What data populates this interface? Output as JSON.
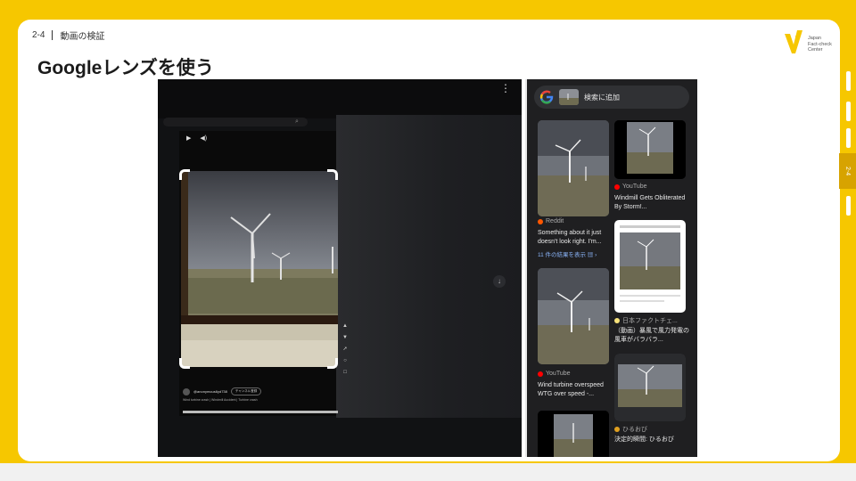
{
  "slide": {
    "section_number": "2-4",
    "section_title": "動画の検証",
    "title": "Googleレンズを使う",
    "side_tab_label": "2-4",
    "logo_lines": [
      "Japan",
      "Fact-check",
      "Center"
    ]
  },
  "colors": {
    "brand_yellow": "#f6c700",
    "tab_active": "#d7a300",
    "lens_dark": "#1f1f21",
    "link_blue": "#8ab4f8"
  },
  "left_screenshot": {
    "menu_icon": "more-vertical-icon",
    "play_icon": "play-icon",
    "volume_icon": "volume-icon",
    "channel_handle": "@anonymous6yd738",
    "subscribe_label": "チャンネル登録",
    "caption": "Wind turbine crash | Windmill Accident | Turbine crash",
    "action_icons": [
      "like-icon",
      "dislike-icon",
      "share-icon",
      "remix-icon",
      "more-icon"
    ]
  },
  "right_screenshot": {
    "search_chip_label": "検索に追加",
    "results": [
      {
        "source": "Reddit",
        "source_color": "#ff5700",
        "title": "Something about it just doesn't look right. I'm...",
        "link": "11 件の結果を表示"
      },
      {
        "source": "YouTube",
        "source_color": "#ff0000",
        "title": "Windmill Gets Obliterated By Storm!..."
      },
      {
        "source": "日本ファクトチェ...",
        "source_color": "#f6e27a",
        "title": "（動画）暴風で風力発電の風車がバラバラ..."
      },
      {
        "source": "YouTube",
        "source_color": "#ff0000",
        "title": "Wind turbine overspeed WTG over speed -..."
      },
      {
        "source": "ひるおび",
        "source_color": "#e0a020",
        "title": "決定的瞬間: ひるおび"
      }
    ]
  }
}
